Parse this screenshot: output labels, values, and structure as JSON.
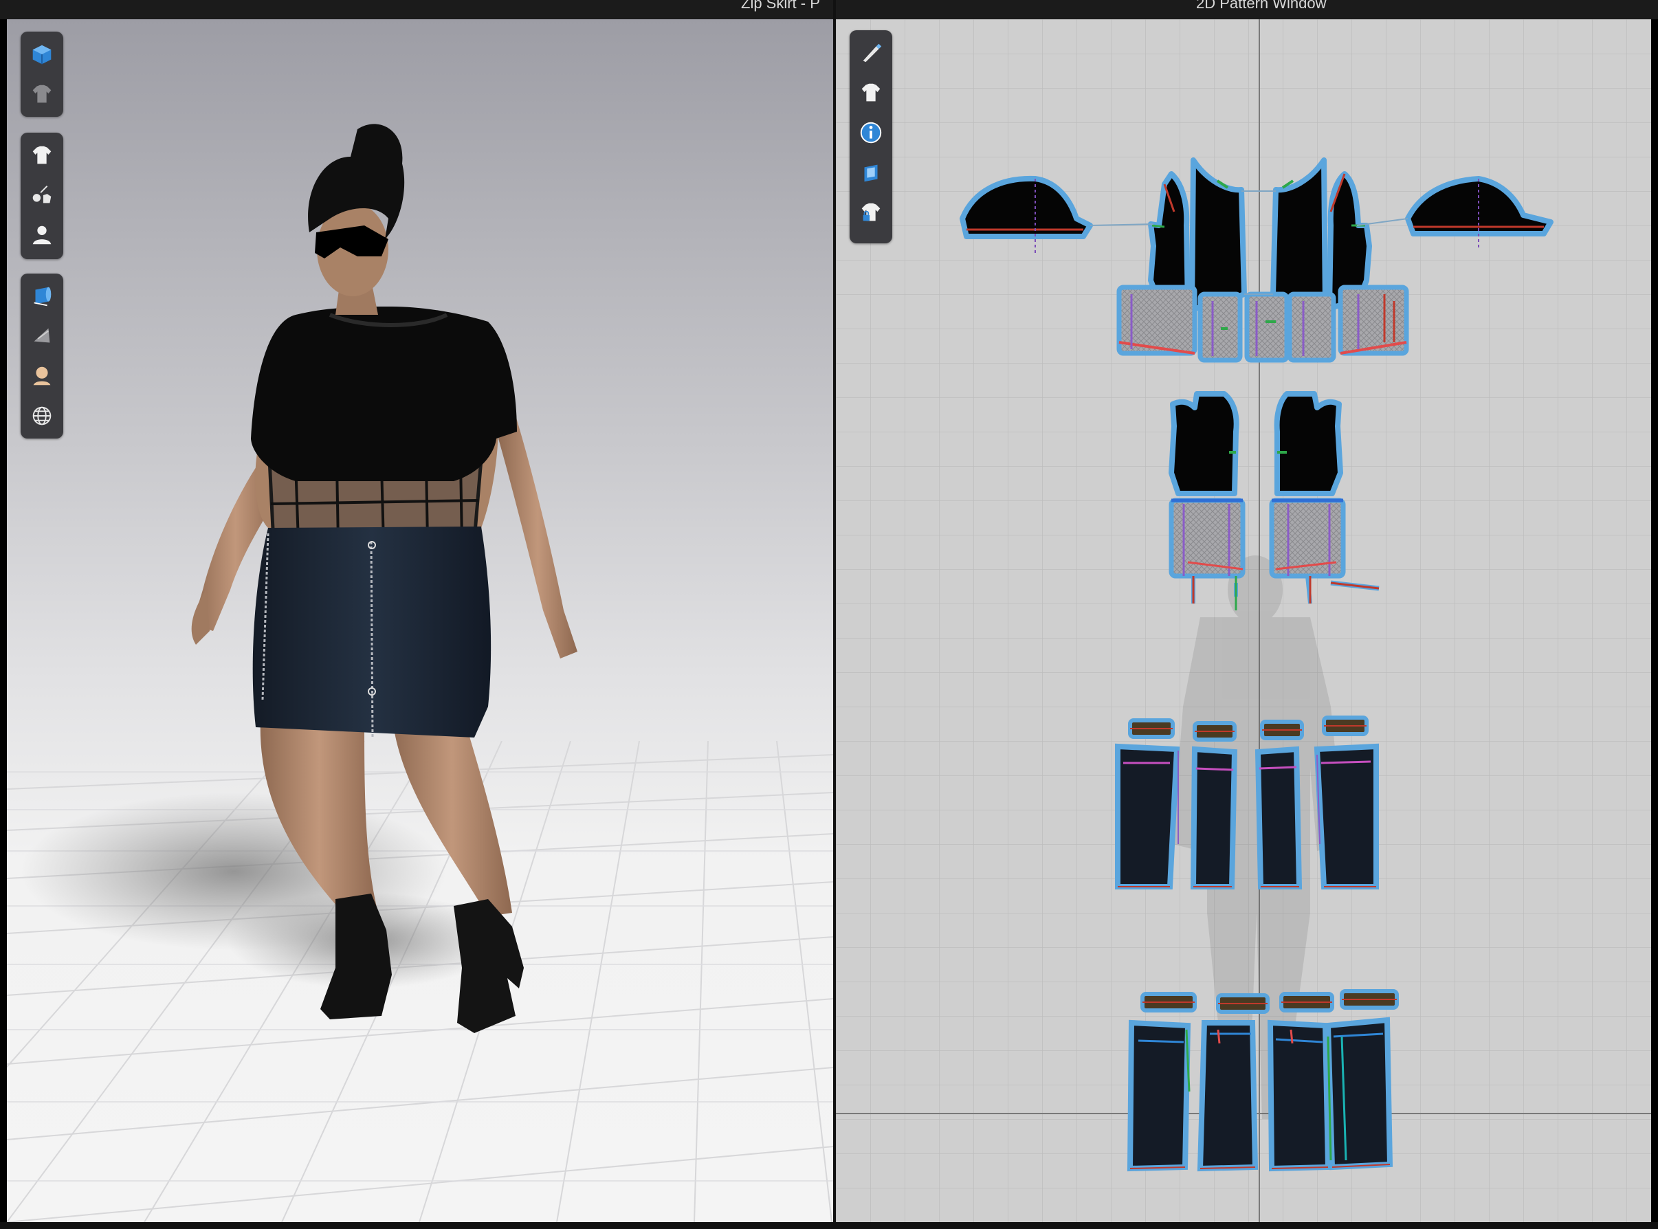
{
  "windows": {
    "viewport_3d": {
      "title": "Zip Skirt - P"
    },
    "pattern_2d": {
      "title": "2D Pattern Window"
    }
  },
  "toolbar_3d": {
    "group_1": [
      {
        "icon": "display-3d-cube-icon"
      },
      {
        "icon": "garment-display-icon"
      }
    ],
    "group_2": [
      {
        "icon": "garment-shirt-icon"
      },
      {
        "icon": "garment-selection-icon"
      },
      {
        "icon": "avatar-icon"
      }
    ],
    "group_3": [
      {
        "icon": "fabric-roll-icon"
      },
      {
        "icon": "mesh-display-icon"
      },
      {
        "icon": "avatar-skin-icon"
      },
      {
        "icon": "environment-globe-icon"
      }
    ]
  },
  "toolbar_2d": [
    {
      "icon": "edit-pattern-pen-icon"
    },
    {
      "icon": "pattern-shirt-icon"
    },
    {
      "icon": "info-icon"
    },
    {
      "icon": "texture-display-icon"
    },
    {
      "icon": "locked-garment-icon"
    }
  ],
  "colors": {
    "top_fabric": "#0a0a0a",
    "skirt_fabric": "#1a2331",
    "mesh_fabric": "#9a9a9a",
    "pattern_outline": "#5aa5dd",
    "toolbar_bg": "#3b3b3f",
    "accent_blue": "#2f86d6"
  }
}
